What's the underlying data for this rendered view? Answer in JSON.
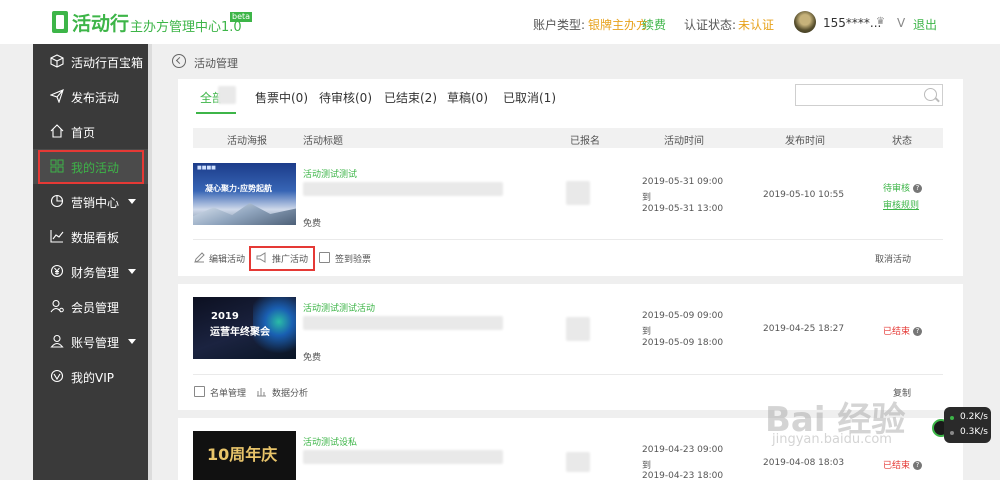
{
  "header": {
    "logo_title": "活动行",
    "logo_subtitle": "主办方管理中心1.0",
    "beta_badge": "beta",
    "account_type_label": "账户类型:",
    "account_type_value": "银牌主办方",
    "renew_link": "续费",
    "auth_label": "认证状态:",
    "auth_value": "未认证",
    "user_phone": "155****...",
    "vip_mark": "V",
    "logout": "退出"
  },
  "sidebar": {
    "items": [
      {
        "label": "活动行百宝箱",
        "icon": "box-icon"
      },
      {
        "label": "发布活动",
        "icon": "send-icon"
      },
      {
        "label": "首页",
        "icon": "home-icon"
      },
      {
        "label": "我的活动",
        "icon": "grid-icon"
      },
      {
        "label": "营销中心",
        "icon": "pie-chart-icon"
      },
      {
        "label": "数据看板",
        "icon": "trend-chart-icon"
      },
      {
        "label": "财务管理",
        "icon": "yen-icon"
      },
      {
        "label": "会员管理",
        "icon": "member-icon"
      },
      {
        "label": "账号管理",
        "icon": "user-icon"
      },
      {
        "label": "我的VIP",
        "icon": "vip-icon"
      }
    ]
  },
  "breadcrumb": "活动管理",
  "tabs": [
    {
      "label": "全部"
    },
    {
      "label": "售票中(0)"
    },
    {
      "label": "待审核(0)"
    },
    {
      "label": "已结束(2)"
    },
    {
      "label": "草稿(0)"
    },
    {
      "label": "已取消(1)"
    }
  ],
  "search": {
    "placeholder": ""
  },
  "table_headers": [
    "活动海报",
    "活动标题",
    "已报名",
    "活动时间",
    "发布时间",
    "状态"
  ],
  "events": [
    {
      "title": "活动测试测试",
      "price": "免费",
      "time_start": "2019-05-31 09:00",
      "time_to": "到",
      "time_end": "2019-05-31 13:00",
      "publish_time": "2019-05-10 10:55",
      "status": "待审核",
      "status_link": "审核规则",
      "poster_text": "凝心聚力·应势起航",
      "actions": [
        "编辑活动",
        "推广活动",
        "签到验票"
      ],
      "right_action": "取消活动"
    },
    {
      "title": "活动测试测试活动",
      "price": "免费",
      "time_start": "2019-05-09 09:00",
      "time_to": "到",
      "time_end": "2019-05-09 18:00",
      "publish_time": "2019-04-25 18:27",
      "status": "已结束",
      "poster_text_year": "2019",
      "poster_text": "运营年终聚会",
      "actions": [
        "名单管理",
        "数据分析"
      ],
      "right_action": "复制"
    },
    {
      "title": "活动测试设私",
      "time_start": "2019-04-23 09:00",
      "time_to": "到",
      "time_end": "2019-04-23 18:00",
      "publish_time": "2019-04-08 18:03",
      "status": "已结束",
      "poster_text": "10周年庆"
    }
  ],
  "widget": {
    "up_speed": "0.2K/s",
    "down_speed": "0.3K/s"
  },
  "watermark": {
    "main": "Bai 经验",
    "sub": "jingyan.baidu.com"
  },
  "colors": {
    "accent": "#3db548",
    "gold": "#e7a21c",
    "danger": "#e53935",
    "sidebar_bg": "#3a3a3a"
  }
}
